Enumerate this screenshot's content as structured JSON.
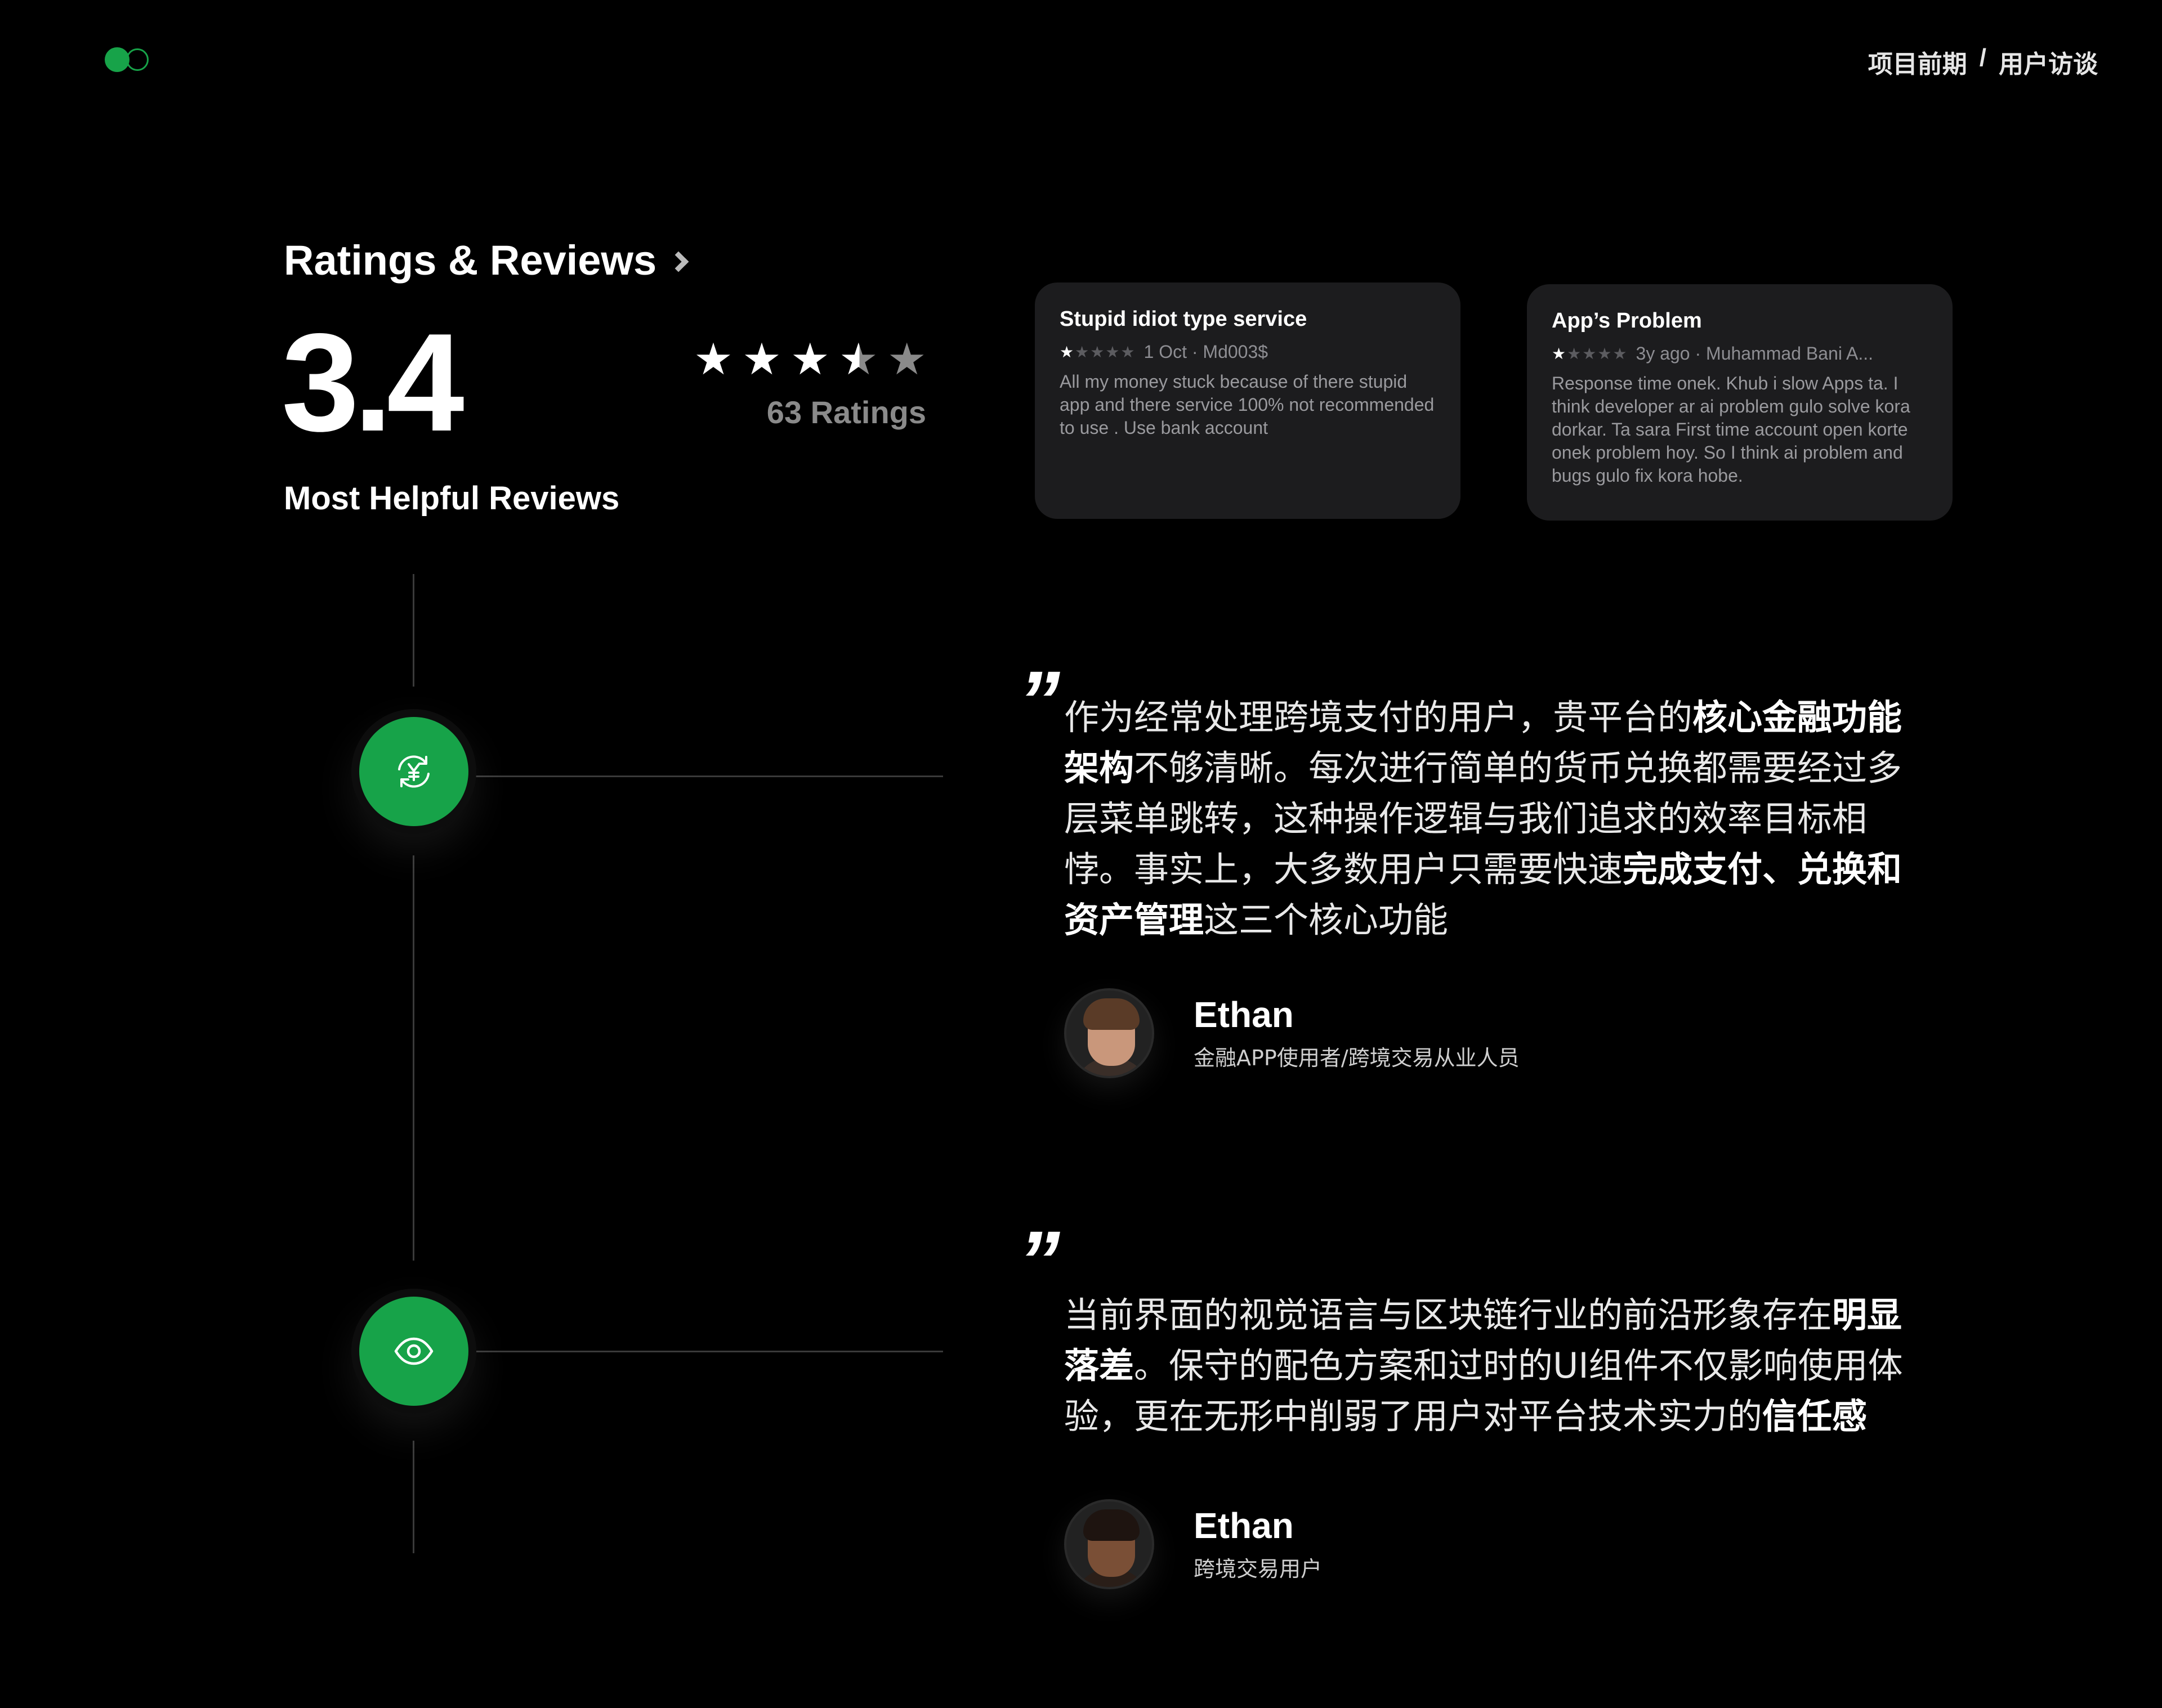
{
  "header": {
    "breadcrumb": [
      "项目前期",
      "/",
      "用户访谈"
    ]
  },
  "ratings": {
    "title": "Ratings & Reviews",
    "score": "3.4",
    "stars": 3.5,
    "count_label": "63 Ratings",
    "subtitle": "Most Helpful Reviews"
  },
  "reviews": [
    {
      "title": "Stupid idiot type service",
      "stars": 1,
      "meta": "1 Oct · Md003$",
      "body": "All my money stuck because of there stupid app and there service 100% not recommended to use . Use bank account"
    },
    {
      "title": "App’s Problem",
      "stars": 1,
      "meta": "3y ago · Muhammad Bani A...",
      "body": "Response time onek. Khub i slow Apps ta. I think developer ar ai problem gulo solve kora dorkar. Ta sara First time account open korte onek problem hoy. So I think ai problem and bugs gulo fix kora hobe."
    }
  ],
  "icons": {
    "node1": "currency-exchange-icon",
    "node2": "eye-icon"
  },
  "colors": {
    "accent": "#17a349",
    "background": "#000000",
    "card": "#1c1c1e"
  },
  "quotes": [
    {
      "mark": "”",
      "segments": [
        {
          "text": "作为经常处理跨境支付的用户，贵平台的",
          "bold": false
        },
        {
          "text": "核心金融功能架构",
          "bold": true
        },
        {
          "text": "不够清晰。每次进行简单的货币兑换都需要经过多层菜单跳转，这种操作逻辑与我们追求的效率目标相悖。事实上，大多数用户只需要快速",
          "bold": false
        },
        {
          "text": "完成支付、兑换和资产管理",
          "bold": true
        },
        {
          "text": "这三个核心功能",
          "bold": false
        }
      ],
      "author": "Ethan",
      "role": "金融APP使用者/跨境交易从业人员"
    },
    {
      "mark": "”",
      "segments": [
        {
          "text": "当前界面的视觉语言与区块链行业的前沿形象存在",
          "bold": false
        },
        {
          "text": "明显落差",
          "bold": true
        },
        {
          "text": "。保守的配色方案和过时的UI组件不仅影响使用体验，更在无形中削弱了用户对平台技术实力的",
          "bold": false
        },
        {
          "text": "信任感",
          "bold": true
        }
      ],
      "author": "Ethan",
      "role": "跨境交易用户"
    }
  ]
}
